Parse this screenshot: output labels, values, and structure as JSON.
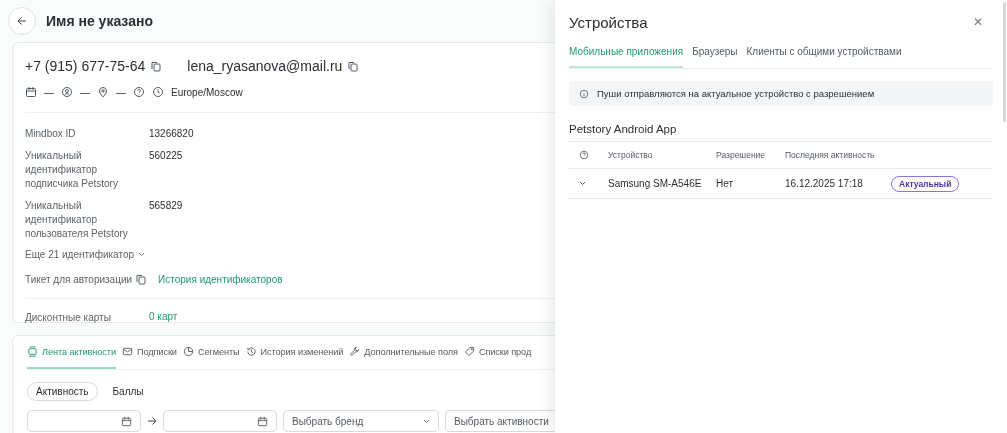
{
  "page": {
    "title": "Имя не указано"
  },
  "contacts": {
    "phone": "+7 (915) 677-75-64",
    "email": "lena_ryasanova@mail.ru",
    "birthday": "—",
    "gender": "—",
    "location": "—",
    "timezone": "Europe/Moscow"
  },
  "identifiers": [
    {
      "label": "Mindbox ID",
      "value": "13266820"
    },
    {
      "label": "Уникальный идентификатор подписчика Petstory",
      "value": "560225"
    },
    {
      "label": "Уникальный идентификатор пользователя Petstory",
      "value": "565829"
    }
  ],
  "more_identifiers": "Еще 21 идентификатор",
  "auth_ticket": "Тикет для авторизации",
  "id_history_link": "История идентификаторов",
  "discount_cards": {
    "label": "Дисконтные карты",
    "value": "0 карт"
  },
  "tabs": [
    {
      "label": "Лента активности",
      "selected": true
    },
    {
      "label": "Подписки",
      "selected": false
    },
    {
      "label": "Сегменты",
      "selected": false
    },
    {
      "label": "История изменений",
      "selected": false
    },
    {
      "label": "Дополнительные поля",
      "selected": false
    },
    {
      "label": "Списки прод",
      "selected": false
    }
  ],
  "subtabs": [
    {
      "label": "Активность",
      "selected": true
    },
    {
      "label": "Баллы",
      "selected": false
    }
  ],
  "filters": {
    "brand_placeholder": "Выбрать бренд",
    "activity_placeholder": "Выбрать активности"
  },
  "drawer": {
    "title": "Устройства",
    "close": "✕",
    "tabs": [
      {
        "label": "Мобильные приложения",
        "selected": true
      },
      {
        "label": "Браузеры",
        "selected": false
      },
      {
        "label": "Клиенты с общими устройствами",
        "selected": false
      }
    ],
    "notice": "Пуши отправляются на актуальное устройство с разрешением",
    "app_title": "Petstory Android App",
    "columns": [
      "Устройство",
      "Разрешение",
      "Последняя активность"
    ],
    "rows": [
      {
        "device": "Samsung SM-A546E",
        "permission": "Нет",
        "last_activity": "16.12.2025 17:18",
        "status": "Актуальный"
      }
    ]
  }
}
